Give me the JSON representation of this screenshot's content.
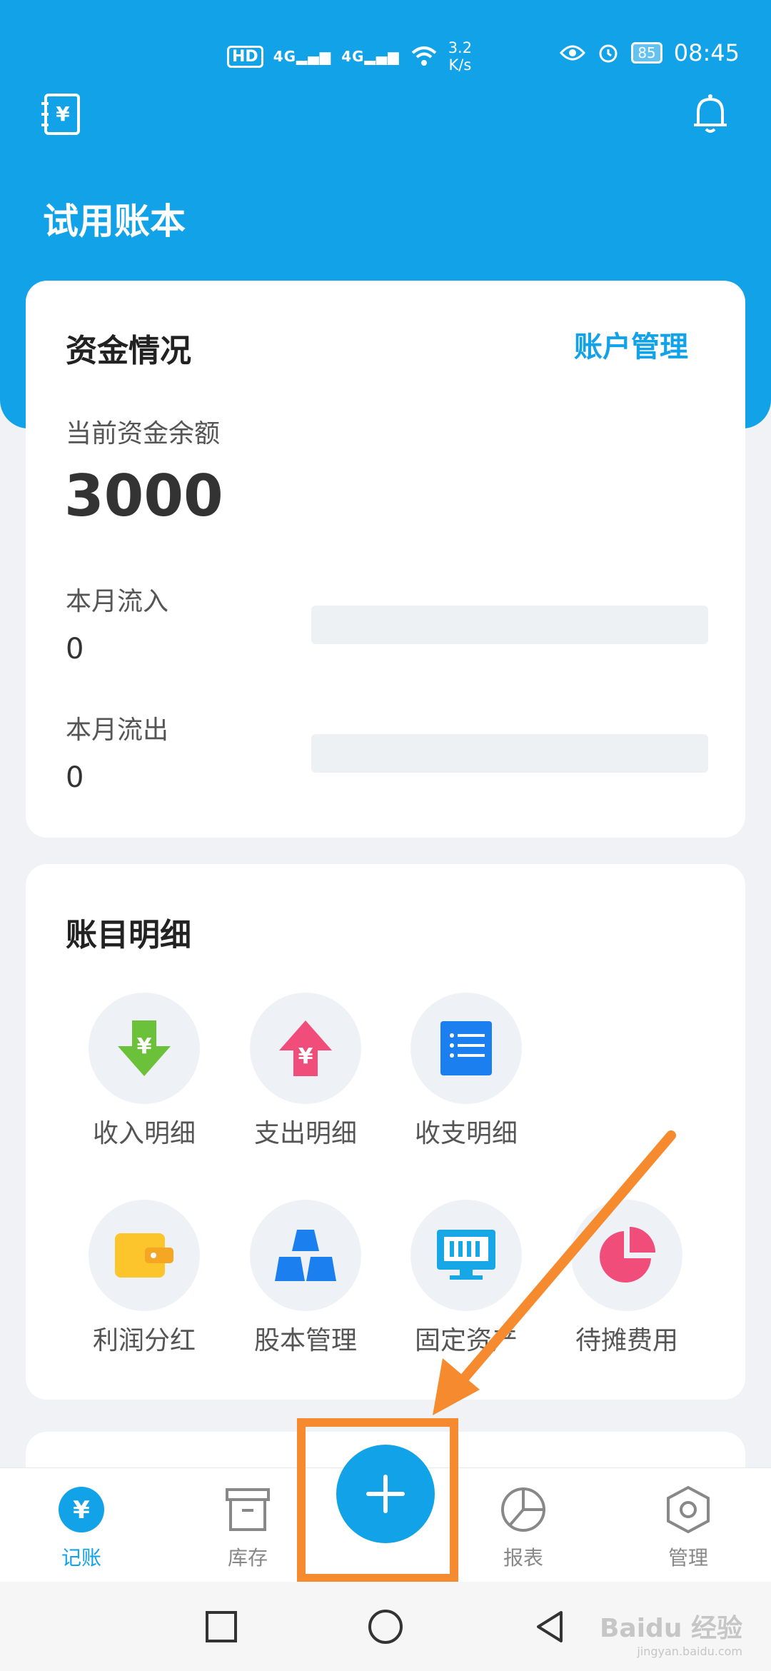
{
  "status_bar": {
    "hd_badge": "HD",
    "signal1": "4G",
    "signal2": "4G",
    "speed_value": "3.2",
    "speed_unit": "K/s",
    "battery": "85",
    "time": "08:45"
  },
  "header": {
    "title": "试用账本"
  },
  "funds_card": {
    "title": "资金情况",
    "manage_link": "账户管理",
    "balance_label": "当前资金余额",
    "balance_value": "3000",
    "inflow_label": "本月流入",
    "inflow_value": "0",
    "outflow_label": "本月流出",
    "outflow_value": "0"
  },
  "details_card": {
    "title": "账目明细",
    "items": [
      {
        "label": "收入明细",
        "icon": "income-arrow-icon",
        "color": "#6cc13a"
      },
      {
        "label": "支出明细",
        "icon": "expense-arrow-icon",
        "color": "#f04d7a"
      },
      {
        "label": "收支明细",
        "icon": "list-icon",
        "color": "#1b7ff0"
      },
      {
        "label": "利润分红",
        "icon": "wallet-icon",
        "color": "#fcc52c"
      },
      {
        "label": "股本管理",
        "icon": "stack-icon",
        "color": "#1b7ff0"
      },
      {
        "label": "固定资产",
        "icon": "monitor-icon",
        "color": "#17a7e6"
      },
      {
        "label": "待摊费用",
        "icon": "pie-icon",
        "color": "#f04d7a"
      }
    ]
  },
  "tabbar": {
    "tabs": [
      {
        "label": "记账",
        "icon": "yen-circle-icon",
        "active": true
      },
      {
        "label": "库存",
        "icon": "archive-icon",
        "active": false
      },
      {
        "label": "报表",
        "icon": "pie-chart-icon",
        "active": false
      },
      {
        "label": "管理",
        "icon": "hexagon-settings-icon",
        "active": false
      }
    ],
    "fab_icon": "plus-icon"
  },
  "watermark": {
    "brand": "Baidu 经验",
    "url": "jingyan.baidu.com"
  },
  "colors": {
    "brand": "#12a2e8",
    "highlight": "#f58b2e"
  }
}
